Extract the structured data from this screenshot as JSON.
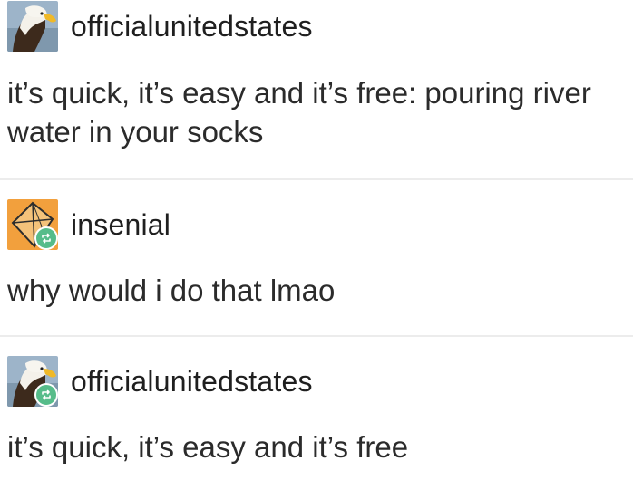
{
  "colors": {
    "background": "#ffffff",
    "text": "#2b2b2b",
    "divider": "#ececec",
    "reblog_badge": "#56bc8a",
    "insenial_avatar": "#f2a03d"
  },
  "posts": [
    {
      "username": "officialunitedstates",
      "avatar_icon": "eagle-avatar",
      "reblogged": false,
      "text": "it’s quick, it’s easy and it’s free: pouring river water in your socks"
    },
    {
      "username": "insenial",
      "avatar_icon": "kite-avatar",
      "reblogged": true,
      "text": "why would i do that lmao"
    },
    {
      "username": "officialunitedstates",
      "avatar_icon": "eagle-avatar",
      "reblogged": true,
      "text": "it’s quick, it’s easy and it’s free"
    }
  ]
}
